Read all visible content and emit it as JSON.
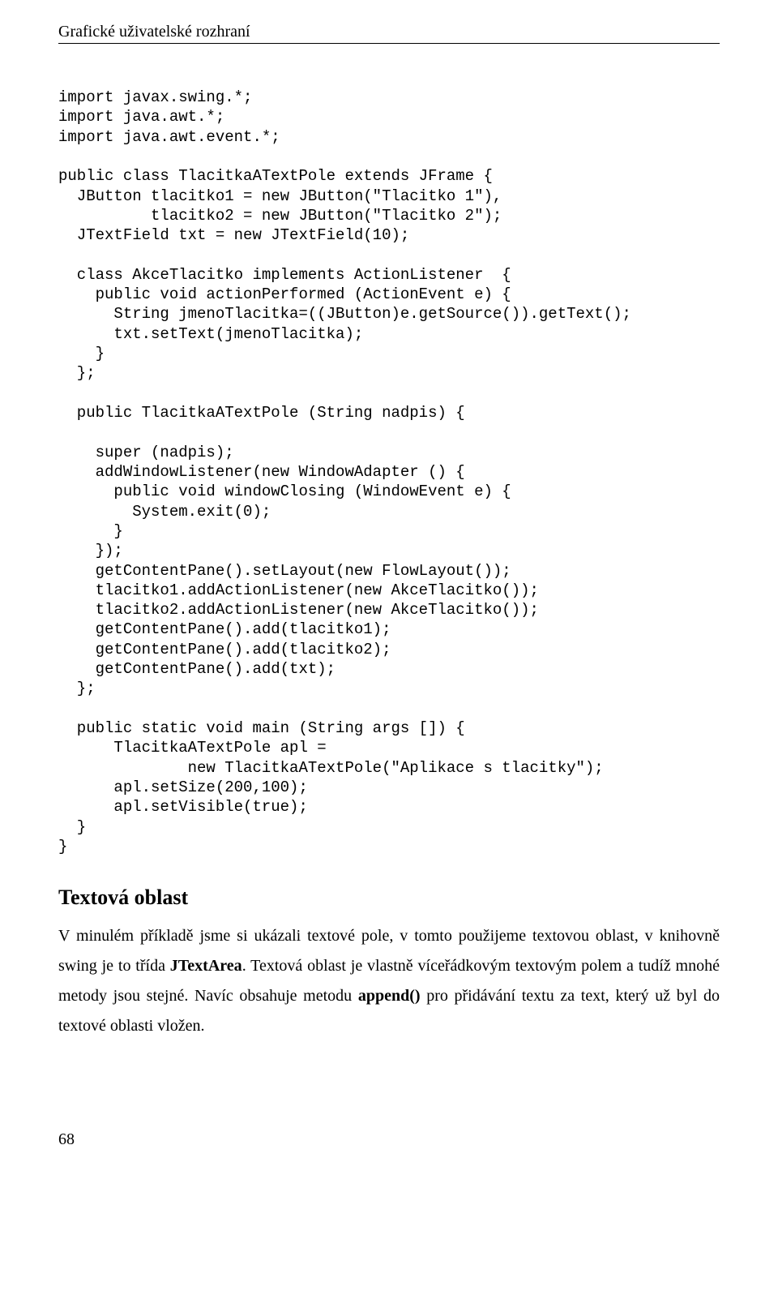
{
  "header": {
    "running_title": "Grafické uživatelské rozhraní"
  },
  "code": "import javax.swing.*;\nimport java.awt.*;\nimport java.awt.event.*;\n\npublic class TlacitkaATextPole extends JFrame {\n  JButton tlacitko1 = new JButton(\"Tlacitko 1\"),\n          tlacitko2 = new JButton(\"Tlacitko 2\");\n  JTextField txt = new JTextField(10);\n\n  class AkceTlacitko implements ActionListener  {\n    public void actionPerformed (ActionEvent e) {\n      String jmenoTlacitka=((JButton)e.getSource()).getText();\n      txt.setText(jmenoTlacitka);\n    }\n  };\n\n  public TlacitkaATextPole (String nadpis) {\n\n    super (nadpis);\n    addWindowListener(new WindowAdapter () {\n      public void windowClosing (WindowEvent e) {\n        System.exit(0);\n      }\n    });\n    getContentPane().setLayout(new FlowLayout());\n    tlacitko1.addActionListener(new AkceTlacitko());\n    tlacitko2.addActionListener(new AkceTlacitko());\n    getContentPane().add(tlacitko1);\n    getContentPane().add(tlacitko2);\n    getContentPane().add(txt);\n  };\n\n  public static void main (String args []) {\n      TlacitkaATextPole apl =\n              new TlacitkaATextPole(\"Aplikace s tlacitky\");\n      apl.setSize(200,100);\n      apl.setVisible(true);\n  }\n}",
  "section": {
    "heading": "Textová oblast",
    "p1_a": "V minulém příkladě jsme si ukázali textové pole, v tomto použijeme textovou oblast, v knihovně swing je to třída ",
    "p1_bold1": "JTextArea",
    "p1_b": ". Textová oblast je vlastně víceřádkovým textovým polem a tudíž mnohé metody jsou stejné. Navíc obsahuje metodu ",
    "p1_bold2": "append()",
    "p1_c": " pro přidávání textu za text, který už byl do textové oblasti vložen."
  },
  "footer": {
    "page_number": "68"
  }
}
